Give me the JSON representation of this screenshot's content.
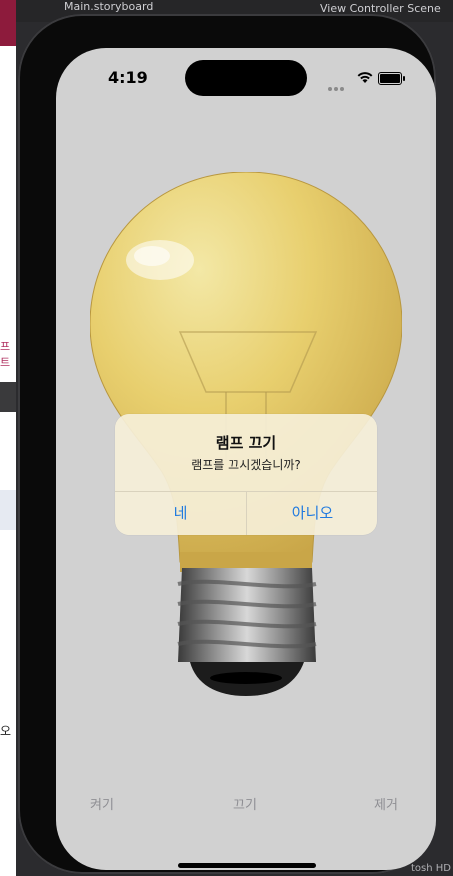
{
  "xcode": {
    "storyboard_tab": "Main.storyboard",
    "scene_tab": "View Controller Scene",
    "sidebar_fragment": "프 트",
    "sidebar_fragment2": "오",
    "device_label": "tosh HD"
  },
  "status_bar": {
    "time": "4:19",
    "icons": [
      "cellular-dots-icon",
      "wifi-icon",
      "battery-icon"
    ]
  },
  "main_image": {
    "icon": "lightbulb-icon",
    "state": "on"
  },
  "alert": {
    "title": "램프 끄기",
    "message": "램프를 끄시겠습니까?",
    "confirm_label": "네",
    "cancel_label": "아니오",
    "button_color": "#1f7ae0"
  },
  "toolbar": {
    "on_label": "켜기",
    "off_label": "끄기",
    "remove_label": "제거"
  },
  "colors": {
    "screen_background": "#d1d1d1",
    "alert_background": "#f5efd8"
  }
}
